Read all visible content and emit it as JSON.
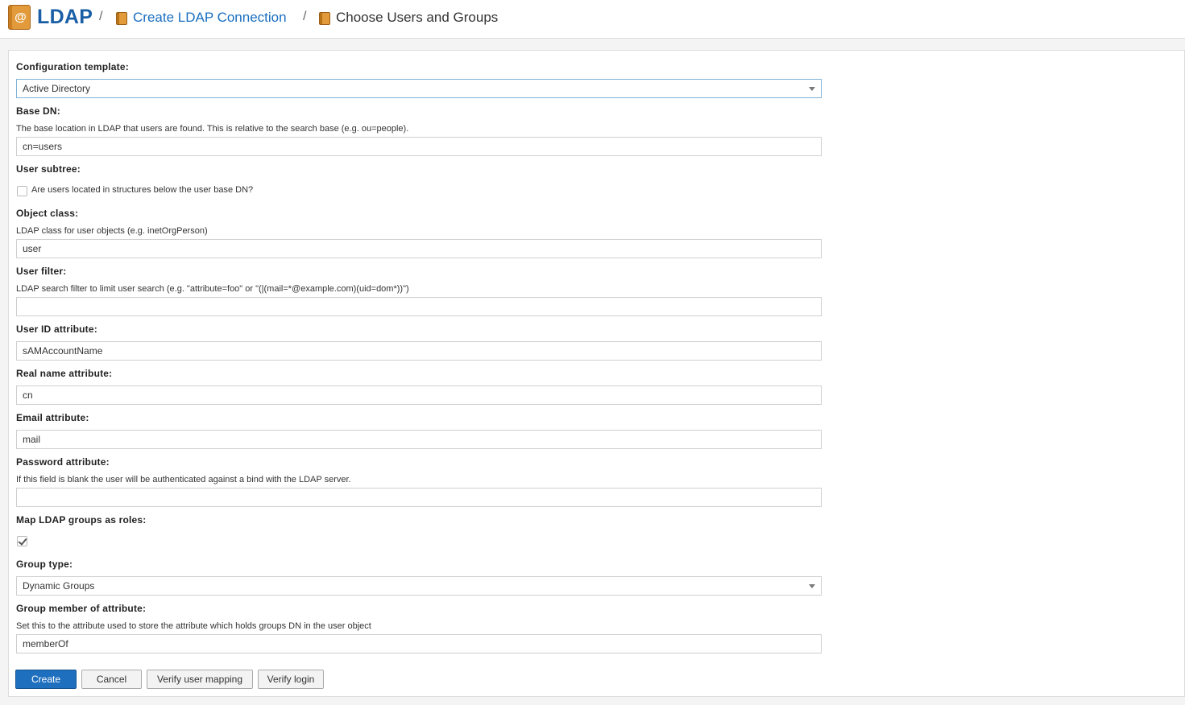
{
  "header": {
    "app_title": "LDAP",
    "logo_glyph": "@",
    "separator": "/",
    "breadcrumbs": [
      {
        "label": "Create LDAP Connection",
        "icon": "address-book-icon"
      },
      {
        "label": "Choose Users and Groups",
        "icon": "address-book-icon"
      }
    ]
  },
  "form": {
    "configuration_template": {
      "label": "Configuration template:",
      "value": "Active Directory"
    },
    "base_dn": {
      "label": "Base DN:",
      "help": "The base location in LDAP that users are found. This is relative to the search base (e.g. ou=people).",
      "value": "cn=users"
    },
    "user_subtree": {
      "label": "User subtree:",
      "checkbox_label": "Are users located in structures below the user base DN?",
      "checked": false
    },
    "object_class": {
      "label": "Object class:",
      "help": "LDAP class for user objects (e.g. inetOrgPerson)",
      "value": "user"
    },
    "user_filter": {
      "label": "User filter:",
      "help": "LDAP search filter to limit user search (e.g. \"attribute=foo\" or \"(|(mail=*@example.com)(uid=dom*))\")",
      "value": ""
    },
    "user_id_attribute": {
      "label": "User ID attribute:",
      "value": "sAMAccountName"
    },
    "real_name_attribute": {
      "label": "Real name attribute:",
      "value": "cn"
    },
    "email_attribute": {
      "label": "Email attribute:",
      "value": "mail"
    },
    "password_attribute": {
      "label": "Password attribute:",
      "help": "If this field is blank the user will be authenticated against a bind with the LDAP server.",
      "value": ""
    },
    "map_groups": {
      "label": "Map LDAP groups as roles:",
      "checked": true
    },
    "group_type": {
      "label": "Group type:",
      "value": "Dynamic Groups"
    },
    "group_member_of": {
      "label": "Group member of attribute:",
      "help": "Set this to the attribute used to store the attribute which holds groups DN in the user object",
      "value": "memberOf"
    }
  },
  "buttons": {
    "create": "Create",
    "cancel": "Cancel",
    "verify_mapping": "Verify user mapping",
    "verify_login": "Verify login"
  },
  "colors": {
    "brand_blue": "#1a5fa6",
    "link_blue": "#1a6fc0",
    "primary_button": "#1f6fbf",
    "icon_orange": "#e29a3a"
  }
}
